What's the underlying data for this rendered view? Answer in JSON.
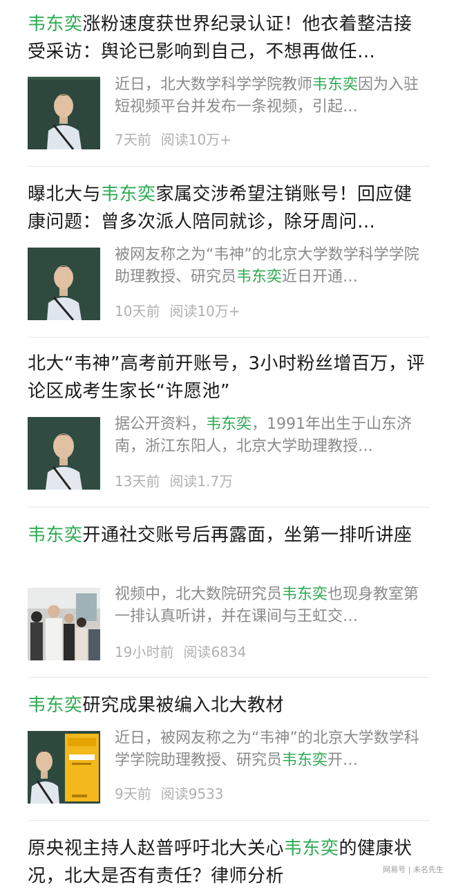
{
  "highlight_color": "#2eaa52",
  "articles": [
    {
      "title_parts": [
        {
          "text": "韦东奕",
          "hl": true
        },
        {
          "text": "涨粉速度获世界纪录认证！他衣着整洁接受采访：舆论已影响到自己，不想再做任…",
          "hl": false
        }
      ],
      "summary_parts": [
        {
          "text": "近日，北大数学科学学院教师",
          "hl": false
        },
        {
          "text": "韦东奕",
          "hl": true
        },
        {
          "text": "因为入驻短视频平台并发布一条视频，引起…",
          "hl": false
        }
      ],
      "time": "7天前",
      "reads": "阅读10万+",
      "thumb_icon": "man-at-blackboard-photo"
    },
    {
      "title_parts": [
        {
          "text": "曝北大与",
          "hl": false
        },
        {
          "text": "韦东奕",
          "hl": true
        },
        {
          "text": "家属交涉希望注销账号！回应健康问题：曾多次派人陪同就诊，除牙周问…",
          "hl": false
        }
      ],
      "summary_parts": [
        {
          "text": "被网友称之为“韦神”的北京大学数学科学学院助理教授、研究员",
          "hl": false
        },
        {
          "text": "韦东奕",
          "hl": true
        },
        {
          "text": "近日开通…",
          "hl": false
        }
      ],
      "time": "10天前",
      "reads": "阅读10万+",
      "thumb_icon": "man-at-blackboard-photo"
    },
    {
      "title_parts": [
        {
          "text": "北大“韦神”高考前开账号，3小时粉丝增百万，评论区成考生家长“许愿池”",
          "hl": false
        }
      ],
      "summary_parts": [
        {
          "text": "据公开资料，",
          "hl": false
        },
        {
          "text": "韦东奕",
          "hl": true
        },
        {
          "text": "，1991年出生于山东济南，浙江东阳人，北京大学助理教授…",
          "hl": false
        }
      ],
      "time": "13天前",
      "reads": "阅读1.7万",
      "thumb_icon": "man-at-blackboard-photo"
    },
    {
      "title_parts": [
        {
          "text": "韦东奕",
          "hl": true
        },
        {
          "text": "开通社交账号后再露面，坐第一排听讲座",
          "hl": false
        }
      ],
      "summary_parts": [
        {
          "text": "视频中，北大数院研究员",
          "hl": false
        },
        {
          "text": "韦东奕",
          "hl": true
        },
        {
          "text": "也现身教室第一排认真听讲，并在课间与王虹交…",
          "hl": false
        }
      ],
      "time": "19小时前",
      "reads": "阅读6834",
      "thumb_icon": "crowd-in-hall-photo"
    },
    {
      "title_parts": [
        {
          "text": "韦东奕",
          "hl": true
        },
        {
          "text": "研究成果被编入北大教材",
          "hl": false
        }
      ],
      "summary_parts": [
        {
          "text": "近日，被网友称之为“韦神”的北京大学数学科学学院助理教授、研究员",
          "hl": false
        },
        {
          "text": "韦东奕",
          "hl": true
        },
        {
          "text": "开…",
          "hl": false
        }
      ],
      "time": "9天前",
      "reads": "阅读9533",
      "thumb_icon": "man-and-textbook-photo"
    },
    {
      "title_parts": [
        {
          "text": "原央视主持人赵普呼吁北大关心",
          "hl": false
        },
        {
          "text": "韦东奕",
          "hl": true
        },
        {
          "text": "的健康状况，北大是否有责任？律师分析",
          "hl": false
        }
      ]
    }
  ],
  "watermark": {
    "brand": "网易号",
    "author": "未名先生"
  }
}
